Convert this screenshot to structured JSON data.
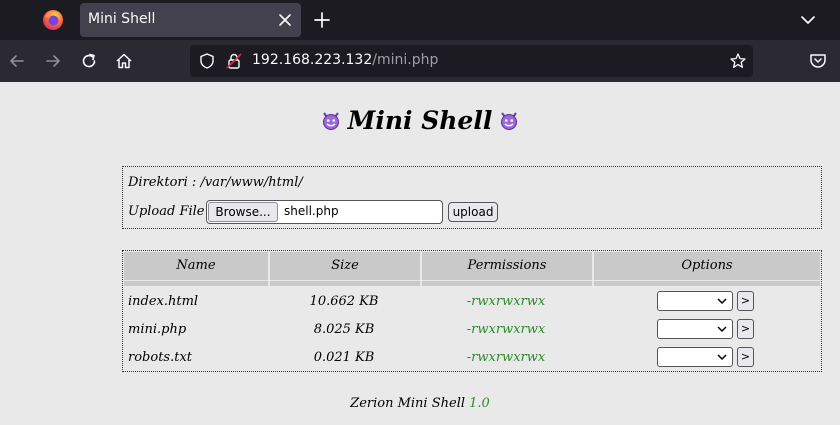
{
  "browser": {
    "tab_title": "Mini Shell",
    "url_host": "192.168.223.132",
    "url_path": "/mini.php"
  },
  "page": {
    "title": "Mini Shell",
    "directory_label": "Direktori : ",
    "directory_path": "/var/www/html/",
    "upload_label": "Upload File :",
    "browse_label": "Browse...",
    "selected_file": "shell.php",
    "upload_button": "upload"
  },
  "table": {
    "headers": [
      "Name",
      "Size",
      "Permissions",
      "Options"
    ],
    "rows": [
      {
        "name": "index.html",
        "size": "10.662 KB",
        "perms": "-rwxrwxrwx",
        "go": ">"
      },
      {
        "name": "mini.php",
        "size": "8.025 KB",
        "perms": "-rwxrwxrwx",
        "go": ">"
      },
      {
        "name": "robots.txt",
        "size": "0.021 KB",
        "perms": "-rwxrwxrwx",
        "go": ">"
      }
    ]
  },
  "footer": {
    "text": "Zerion Mini Shell ",
    "version": "1.0"
  },
  "colors": {
    "tabbar": "#1c1b22",
    "navbar": "#2b2a33",
    "page_bg": "#e9e9e9",
    "header_bg": "#c9c9c9",
    "perm_green": "#2d8a2d"
  },
  "icons": [
    "firefox-logo",
    "close-icon",
    "plus-icon",
    "chevron-down-icon",
    "back-arrow-icon",
    "forward-arrow-icon",
    "reload-icon",
    "home-icon",
    "shield-icon",
    "lock-icon",
    "star-icon",
    "pocket-icon",
    "devil-icon"
  ]
}
